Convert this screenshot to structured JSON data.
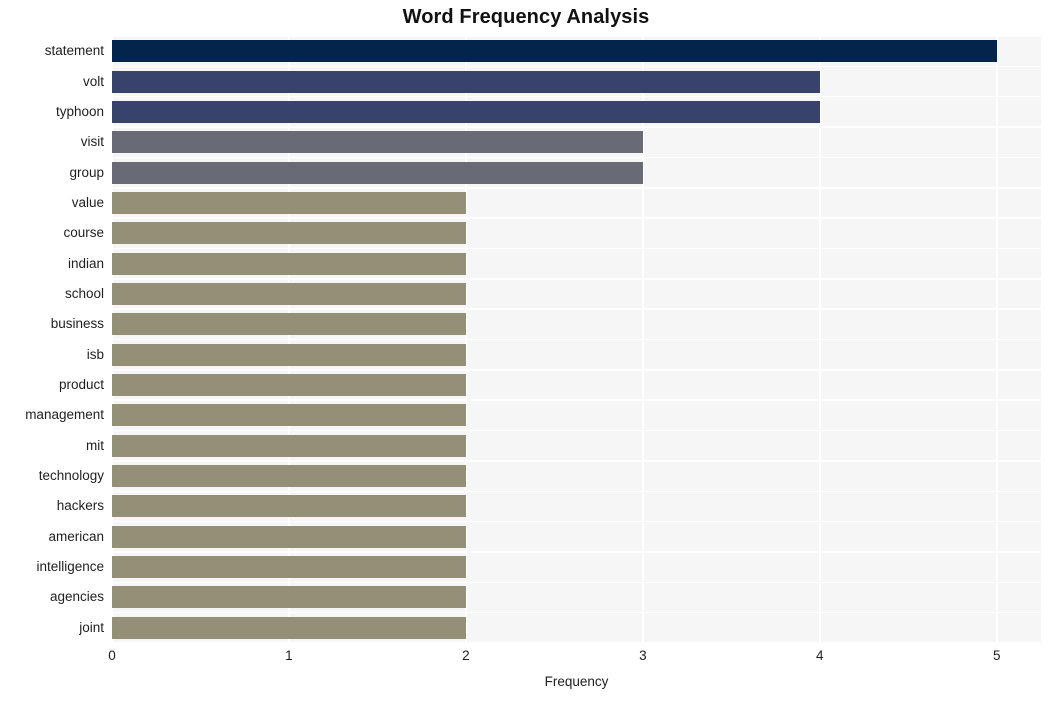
{
  "chart_data": {
    "type": "bar",
    "orientation": "horizontal",
    "title": "Word Frequency Analysis",
    "xlabel": "Frequency",
    "ylabel": "",
    "xlim": [
      0,
      5.25
    ],
    "xticks": [
      0,
      1,
      2,
      3,
      4,
      5
    ],
    "xtick_labels": [
      "0",
      "1",
      "2",
      "3",
      "4",
      "5"
    ],
    "grid": true,
    "legend": "none",
    "categories": [
      "statement",
      "volt",
      "typhoon",
      "visit",
      "group",
      "value",
      "course",
      "indian",
      "school",
      "business",
      "isb",
      "product",
      "management",
      "mit",
      "technology",
      "hackers",
      "american",
      "intelligence",
      "agencies",
      "joint"
    ],
    "values": [
      5,
      4,
      4,
      3,
      3,
      2,
      2,
      2,
      2,
      2,
      2,
      2,
      2,
      2,
      2,
      2,
      2,
      2,
      2,
      2
    ],
    "bar_colors": [
      "#03244b",
      "#37436b",
      "#37436b",
      "#686b76",
      "#686b76",
      "#949077",
      "#949077",
      "#949077",
      "#949077",
      "#949077",
      "#949077",
      "#949077",
      "#949077",
      "#949077",
      "#949077",
      "#949077",
      "#949077",
      "#949077",
      "#949077",
      "#949077"
    ],
    "plot_background": "#f6f6f7",
    "gridline_color": "#ffffff",
    "figure_background": "#ffffff",
    "title_color": "#111111",
    "tick_label_color": "#1f1f1f"
  }
}
